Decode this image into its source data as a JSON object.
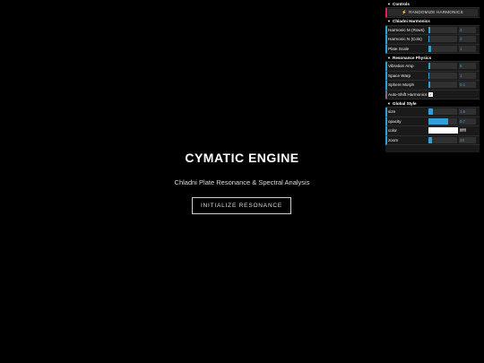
{
  "splash": {
    "title": "CYMATIC ENGINE",
    "subtitle": "Chladni Plate Resonance & Spectral Analysis",
    "button_label": "INITIALIZE RESONANCE"
  },
  "gui": {
    "controls_title": "Controls",
    "randomize_label": "RANDOMIZE HARMONICS",
    "randomize_icon": "⚡",
    "chladni_title": "Chladni Harmonics",
    "chladni": [
      {
        "label": "Harmonic M (Rows)",
        "value": "3",
        "fraction": 0.05
      },
      {
        "label": "Harmonic N (Cols)",
        "value": "2",
        "fraction": 0.03
      },
      {
        "label": "Plate Scale",
        "value": "1",
        "fraction": 0.1
      }
    ],
    "physics_title": "Resonance Physics",
    "physics": [
      {
        "label": "Vibration Amp",
        "value": "6",
        "fraction": 0.06
      },
      {
        "label": "Space Warp",
        "value": "1",
        "fraction": 0.03
      },
      {
        "label": "Sphere Morph",
        "value": "0.1",
        "fraction": 0.06
      }
    ],
    "auto_shift_label": "Auto-Shift Harmonics",
    "auto_shift_checked": "✓",
    "style_title": "Global Style",
    "size": {
      "label": "size",
      "value": "1.6",
      "fraction": 0.15
    },
    "opacity": {
      "label": "opacity",
      "value": "0.7",
      "fraction": 0.7
    },
    "color": {
      "label": "color",
      "value": "ffffff",
      "hex": "#ffffff"
    },
    "zoom": {
      "label": "zoom",
      "value": "28",
      "fraction": 0.12
    }
  },
  "colors": {
    "background": "#000000",
    "panel": "#1a1a1a",
    "slider_fill": "#2fa1d6",
    "number_text": "#2fa1d6"
  }
}
